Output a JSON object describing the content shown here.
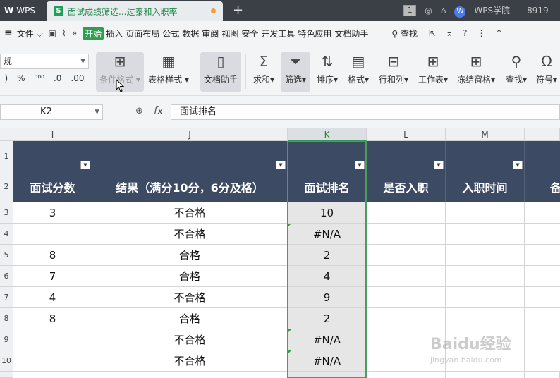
{
  "titlebar": {
    "app": "WPS",
    "tab_title": "面试成绩筛选...过泰和入职率",
    "user_badge": "1",
    "brand": "WPS学院",
    "account": "8919-"
  },
  "menu": {
    "file": "文件",
    "items": [
      "开始",
      "插入",
      "页面布局",
      "公式",
      "数据",
      "审阅",
      "视图",
      "安全",
      "开发工具",
      "特色应用",
      "文档助手"
    ],
    "search": "查找"
  },
  "ribbon": {
    "number_format": "规",
    "buttons": {
      "cond_format": "条件格式",
      "table_style": "表格样式",
      "doc_assistant": "文档助手",
      "sum": "求和",
      "filter": "筛选",
      "sort": "排序",
      "format": "格式",
      "rowcol": "行和列",
      "worksheet": "工作表",
      "freeze": "冻结窗格",
      "find": "查找",
      "symbol": "符号"
    }
  },
  "formula": {
    "cell_ref": "K2",
    "value": "面试排名"
  },
  "grid": {
    "columns": [
      "I",
      "J",
      "K",
      "L",
      "M"
    ],
    "header_row": [
      "面试分数",
      "结果（满分10分，6分及格）",
      "面试排名",
      "是否入职",
      "入职时间",
      "备"
    ],
    "row_numbers": [
      "1",
      "2",
      "3",
      "4",
      "5",
      "6",
      "7",
      "8",
      "9",
      "10"
    ],
    "rows": [
      [
        "3",
        "不合格",
        "10",
        "",
        ""
      ],
      [
        "",
        "不合格",
        "#N/A",
        "",
        ""
      ],
      [
        "8",
        "合格",
        "2",
        "",
        ""
      ],
      [
        "7",
        "合格",
        "4",
        "",
        ""
      ],
      [
        "4",
        "不合格",
        "9",
        "",
        ""
      ],
      [
        "8",
        "合格",
        "2",
        "",
        ""
      ],
      [
        "",
        "不合格",
        "#N/A",
        "",
        ""
      ],
      [
        "",
        "不合格",
        "#N/A",
        "",
        ""
      ]
    ]
  },
  "watermark": {
    "text": "Baidu经验",
    "url": "jingyan.baidu.com"
  }
}
